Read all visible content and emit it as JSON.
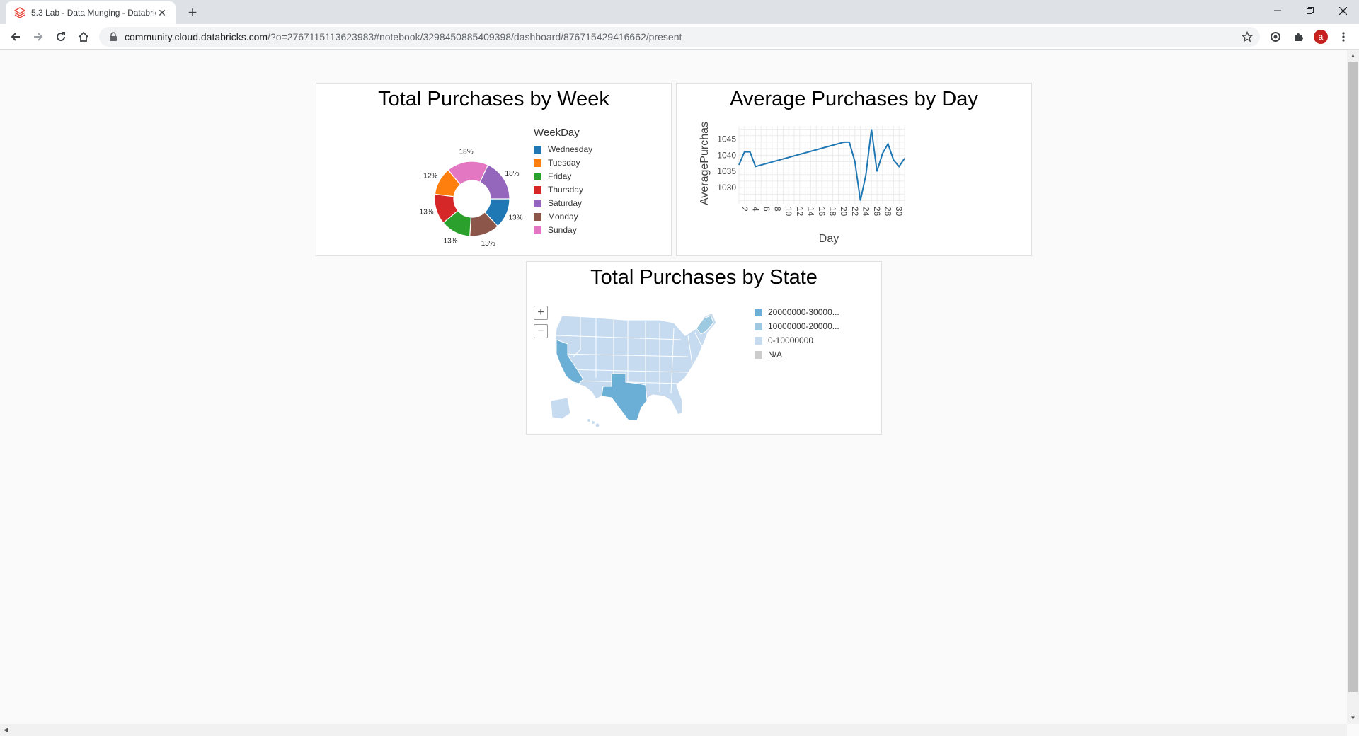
{
  "browser": {
    "tab_title": "5.3 Lab - Data Munging - Databricks",
    "url_host": "community.cloud.databricks.com",
    "url_path": "/?o=2767115113623983#notebook/3298450885409398/dashboard/876715429416662/present",
    "avatar_letter": "a",
    "icons": [
      "back-icon",
      "forward-icon",
      "reload-icon",
      "home-icon",
      "lock-icon",
      "star-icon",
      "extension-icon",
      "puzzle-icon",
      "menu-icon"
    ]
  },
  "panels": {
    "week": {
      "title": "Total Purchases by Week"
    },
    "day": {
      "title": "Average Purchases by Day"
    },
    "state": {
      "title": "Total Purchases by State"
    }
  },
  "chart_data": [
    {
      "type": "pie",
      "title": "Total Purchases by Week",
      "legend_title": "WeekDay",
      "legend_placement": "right",
      "donut": true,
      "slices": [
        {
          "label": "Wednesday",
          "value": 13,
          "color": "#1f77b4"
        },
        {
          "label": "Monday",
          "value": 13,
          "color": "#8c564b"
        },
        {
          "label": "Friday",
          "value": 13,
          "color": "#2ca02c"
        },
        {
          "label": "Thursday",
          "value": 13,
          "color": "#d62728"
        },
        {
          "label": "Tuesday",
          "value": 12,
          "color": "#ff7f0e"
        },
        {
          "label": "Sunday",
          "value": 18,
          "color": "#e377c2"
        },
        {
          "label": "Saturday",
          "value": 18,
          "color": "#9467bd"
        }
      ],
      "legend_order": [
        {
          "label": "Wednesday",
          "color": "#1f77b4"
        },
        {
          "label": "Tuesday",
          "color": "#ff7f0e"
        },
        {
          "label": "Friday",
          "color": "#2ca02c"
        },
        {
          "label": "Thursday",
          "color": "#d62728"
        },
        {
          "label": "Saturday",
          "color": "#9467bd"
        },
        {
          "label": "Monday",
          "color": "#8c564b"
        },
        {
          "label": "Sunday",
          "color": "#e377c2"
        }
      ]
    },
    {
      "type": "line",
      "title": "Average Purchases by Day",
      "xlabel": "Day",
      "ylabel": "AveragePurchas",
      "x_ticks": [
        2,
        4,
        6,
        8,
        10,
        12,
        14,
        16,
        18,
        20,
        22,
        24,
        26,
        28,
        30
      ],
      "y_ticks": [
        1030,
        1035,
        1040,
        1045
      ],
      "xlim": [
        1,
        31
      ],
      "ylim": [
        1025,
        1049
      ],
      "grid": true,
      "color": "#1f77b4",
      "x": [
        1,
        2,
        3,
        4,
        20,
        21,
        22,
        23,
        24,
        25,
        26,
        27,
        28,
        29,
        30
      ],
      "y": [
        1037,
        1041,
        1041,
        1036.5,
        1044,
        1044,
        1038,
        1026,
        1034,
        1048,
        1035,
        1040.5,
        1043.5,
        1038.5,
        1036.5,
        1039
      ]
    },
    {
      "type": "map",
      "title": "Total Purchases by State",
      "legend_placement": "right",
      "legend": [
        {
          "label": "20000000-30000...",
          "color": "#6baed6"
        },
        {
          "label": "10000000-20000...",
          "color": "#9ecae1"
        },
        {
          "label": "0-10000000",
          "color": "#c6dbef"
        },
        {
          "label": "N/A",
          "color": "#cccccc"
        }
      ],
      "highlighted_states": {
        "California": "20000000-30000...",
        "Texas": "20000000-30000..."
      }
    }
  ]
}
